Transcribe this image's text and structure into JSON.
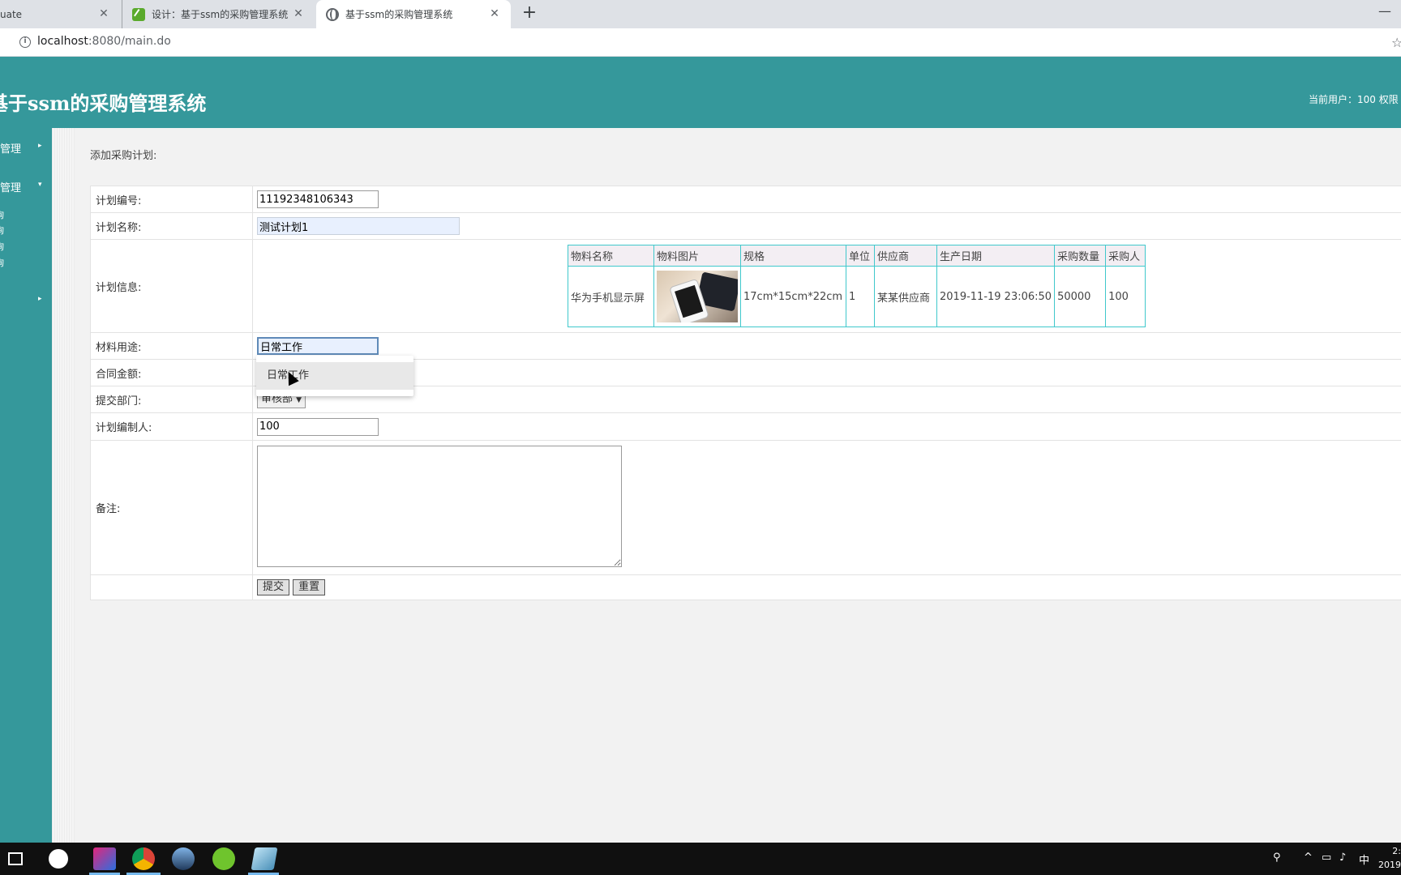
{
  "browser": {
    "tabs": [
      {
        "title": "uate",
        "active": false
      },
      {
        "title": "设计：基于ssm的采购管理系统",
        "active": false
      },
      {
        "title": "基于ssm的采购管理系统",
        "active": true
      }
    ],
    "close_glyph": "✕",
    "new_tab_glyph": "+",
    "minimize_glyph": "—",
    "url_host": "localhost",
    "url_rest": ":8080/main.do"
  },
  "app": {
    "title": "基于ssm的采购管理系统",
    "user_info": "当前用户：100   权限",
    "header_color": "#35989b"
  },
  "sidebar": {
    "menus": [
      {
        "label": "管理",
        "arrow": "▸"
      },
      {
        "label": "管理",
        "arrow": "▾"
      },
      {
        "label": "",
        "arrow": "▸"
      }
    ],
    "subitems": [
      "询",
      "询",
      "询",
      "询"
    ]
  },
  "page": {
    "heading": "添加采购计划:",
    "fields": {
      "plan_no_label": "计划编号:",
      "plan_no_value": "11192348106343",
      "plan_name_label": "计划名称:",
      "plan_name_value": "测试计划1",
      "plan_info_label": "计划信息:",
      "usage_label": "材料用途:",
      "usage_value": "日常工作",
      "amount_label": "合同金额:",
      "dept_label": "提交部门:",
      "dept_value": "审核部",
      "maker_label": "计划编制人:",
      "maker_value": "100",
      "remark_label": "备注:"
    },
    "materials": {
      "headers": [
        "物料名称",
        "物料图片",
        "规格",
        "单位",
        "供应商",
        "生产日期",
        "采购数量",
        "采购人"
      ],
      "row": {
        "name": "华为手机显示屏",
        "spec": "17cm*15cm*22cm",
        "unit": "1",
        "supplier": "某某供应商",
        "date": "2019-11-19 23:06:50",
        "qty": "50000",
        "buyer": "100"
      }
    },
    "buttons": {
      "submit": "提交",
      "reset": "重置"
    },
    "autocomplete_option": "日常工作"
  },
  "taskbar": {
    "clock_line1": "2:",
    "clock_line2": "2019",
    "ime": "中"
  }
}
